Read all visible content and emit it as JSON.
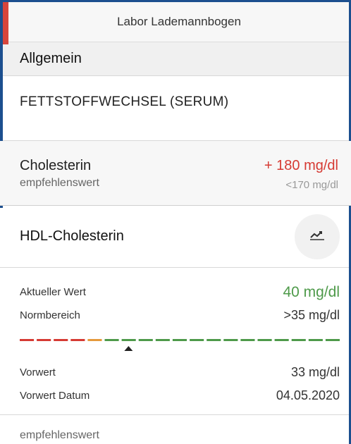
{
  "header": {
    "title": "Labor Lademannbogen"
  },
  "section": {
    "title": "Allgemein"
  },
  "group": {
    "title": "FETTSTOFFWECHSEL (SERUM)"
  },
  "cholesterin": {
    "name": "Cholesterin",
    "sub": "empfehlenswert",
    "value": "+ 180 mg/dl",
    "reference": "<170 mg/dl",
    "value_color": "#d63a33"
  },
  "hdl": {
    "name": "HDL-Cholesterin",
    "trend_icon": "trend-chart-icon",
    "current_label": "Aktueller Wert",
    "current_value": "40 mg/dl",
    "current_color": "#4e9a4a",
    "normal_label": "Normbereich",
    "normal_value": ">35 mg/dl",
    "previous_label": "Vorwert",
    "previous_value": "33 mg/dl",
    "previous_date_label": "Vorwert Datum",
    "previous_date_value": "04.05.2020",
    "range_bar": {
      "segment_colors": [
        "#d63a33",
        "#d63a33",
        "#d63a33",
        "#d63a33",
        "#e59a3c",
        "#4e9a4a",
        "#4e9a4a",
        "#4e9a4a",
        "#4e9a4a",
        "#4e9a4a",
        "#4e9a4a",
        "#4e9a4a",
        "#4e9a4a",
        "#4e9a4a",
        "#4e9a4a",
        "#4e9a4a",
        "#4e9a4a",
        "#4e9a4a",
        "#4e9a4a"
      ],
      "marker_fraction": 0.34
    }
  },
  "footer": {
    "text": "empfehlenswert"
  }
}
